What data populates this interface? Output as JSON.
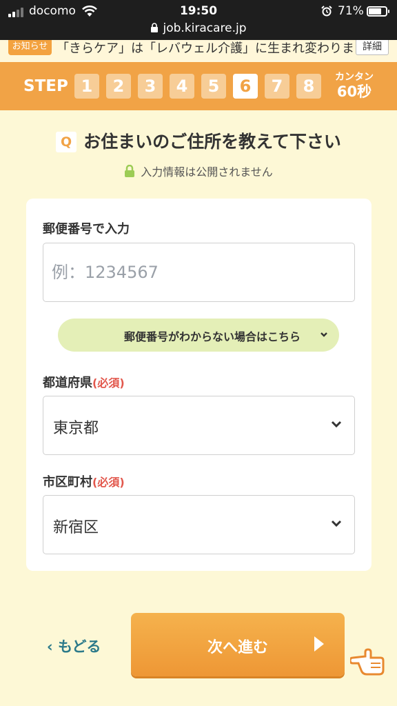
{
  "status": {
    "carrier": "docomo",
    "time": "19:50",
    "battery": "71%",
    "url": "job.kiracare.jp"
  },
  "notice": {
    "badge": "お知らせ",
    "text": "「きらケア」は「レバウェル介護」に生まれ変わりました",
    "detail": "詳細"
  },
  "stepbar": {
    "label": "STEP",
    "steps": [
      "1",
      "2",
      "3",
      "4",
      "5",
      "6",
      "7",
      "8"
    ],
    "current": 6,
    "kantan": "カンタン",
    "seconds": "60秒"
  },
  "question": {
    "badge": "Q",
    "text": "お住まいのご住所を教えて下さい",
    "privacy": "入力情報は公開されません"
  },
  "form": {
    "postal_label": "郵便番号で入力",
    "postal_placeholder": "例：1234567",
    "postal_help": "郵便番号がわからない場合はこちら",
    "prefecture_label": "都道府県",
    "prefecture_required": "(必須)",
    "prefecture_value": "東京都",
    "city_label": "市区町村",
    "city_required": "(必須)",
    "city_value": "新宿区"
  },
  "nav": {
    "back": "もどる",
    "next": "次へ進む"
  },
  "colors": {
    "accent": "#f1a346",
    "background": "#fdf8d6",
    "back_link": "#2c7a8a",
    "required": "#e2574c"
  }
}
